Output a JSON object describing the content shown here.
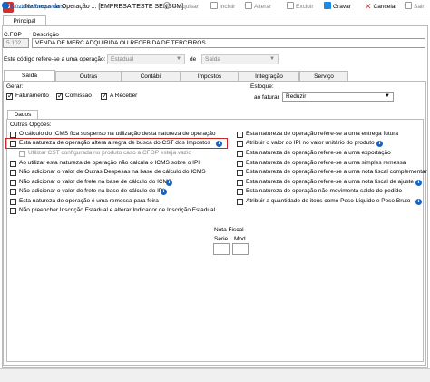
{
  "window": {
    "title": ".:: Natureza da Operação ::. [EMPRESA TESTE SENSUM]",
    "icon_letter": "S"
  },
  "top_tab": {
    "label": "Principal"
  },
  "cfop": {
    "label": "C.FOP",
    "value": "5.102"
  },
  "descricao": {
    "label": "Descrição",
    "value": "VENDA DE MERC ADQUIRIDA OU RECEBIDA DE TERCEIROS"
  },
  "refers": {
    "label": "Este código refere-se a uma operação:",
    "scope_value": "Estadual",
    "de_label": "de",
    "direction_value": "Saída"
  },
  "subtabs": [
    "Saída",
    "Outras",
    "Contábil",
    "Impostos",
    "Integração",
    "Serviço"
  ],
  "active_subtab": "Saída",
  "gerar": {
    "label": "Gerar:",
    "items": [
      {
        "label": "Faturamento",
        "checked": true
      },
      {
        "label": "Comissão",
        "checked": true
      },
      {
        "label": "A Receber",
        "checked": true
      }
    ]
  },
  "estoque": {
    "label": "Estoque:",
    "ao_faturar_label": "ao faturar",
    "value": "Reduzir"
  },
  "dados_tab": {
    "label": "Dados"
  },
  "outras_opcoes": {
    "label": "Outras Opções:"
  },
  "left_options": [
    {
      "label": "O cálculo do ICMS fica suspenso na utilização desta natureza de operação",
      "checked": false,
      "info": false
    },
    {
      "label": "Esta natureza de operação altera a regra de busca do CST dos Impostos",
      "checked": false,
      "info": true
    },
    {
      "label": "Utilizar CST configurada no produto caso a CFOP esteja vazio",
      "checked": false,
      "info": false,
      "disabled": true
    },
    {
      "label": "Ao utilizar esta natureza de operação não calcula o ICMS sobre o IPI",
      "checked": false,
      "info": false
    },
    {
      "label": "Não adicionar o valor de Outras Despesas na base de cálculo do ICMS",
      "checked": false,
      "info": false
    },
    {
      "label": "Não adicionar o valor de frete na base de cálculo do ICMS",
      "checked": false,
      "info": true
    },
    {
      "label": "Não adicionar o valor de frete na base de cálculo do IPI",
      "checked": false,
      "info": true
    },
    {
      "label": "Esta natureza de operação é uma remessa para feira",
      "checked": false,
      "info": false
    },
    {
      "label": "Não preencher Inscrição Estadual e alterar Indicador de Inscrição Estadual",
      "checked": false,
      "info": false
    }
  ],
  "right_options": [
    {
      "label": "Esta natureza de operação refere-se a uma entrega futura",
      "checked": false,
      "info": false
    },
    {
      "label": "Atribuir o valor do IPI no valor unitário do produto",
      "checked": false,
      "info": true
    },
    {
      "label": "Esta natureza de operação refere-se a uma exportação",
      "checked": false,
      "info": false
    },
    {
      "label": "Esta natureza de operação refere-se a uma simples remessa",
      "checked": false,
      "info": false
    },
    {
      "label": "Esta natureza de operação refere-se a uma nota fiscal complementar",
      "checked": false,
      "info": false
    },
    {
      "label": "Esta natureza de operação refere-se a uma nota fiscal de ajuste",
      "checked": false,
      "info": true
    },
    {
      "label": "Esta natureza de operação não movimenta saldo do pedido",
      "checked": false,
      "info": false
    },
    {
      "label": "Atribuir a quantidade de itens como Peso Líquido e Peso Bruto",
      "checked": false,
      "info": true
    }
  ],
  "nota_fiscal": {
    "label": "Nota Fiscal",
    "serie_label": "Série",
    "mod_label": "Mod",
    "serie_value": "",
    "mod_value": ""
  },
  "toolbar": {
    "duvidas": "Dúvidas Frequentes",
    "pesquisar": "Pesquisar",
    "incluir": "Incluir",
    "alterar": "Alterar",
    "excluir": "Excluir",
    "gravar": "Gravar",
    "cancelar": "Cancelar",
    "sair": "Sair"
  },
  "colors": {
    "accent": "#1565c0",
    "highlight": "#c62828",
    "gravar_icon": "#1e88e5",
    "cancelar_icon": "#e53935"
  }
}
